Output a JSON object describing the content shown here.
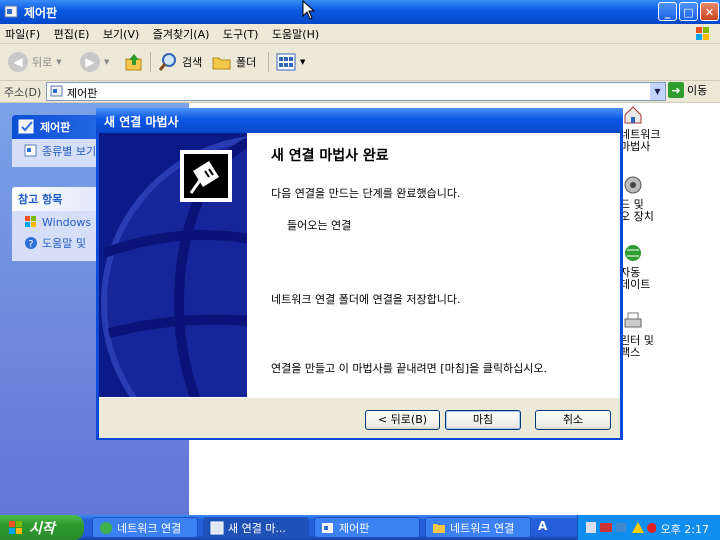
{
  "window": {
    "title": "제어판",
    "menu": [
      "파일(F)",
      "편집(E)",
      "보기(V)",
      "즐겨찾기(A)",
      "도구(T)",
      "도움말(H)"
    ],
    "toolbar": {
      "back_label": "뒤로",
      "search_label": "검색",
      "folders_label": "폴더"
    },
    "address": {
      "label": "주소(D)",
      "value": "제어판",
      "go_label": "이동"
    }
  },
  "taskpane": {
    "panel1": {
      "title": "제어판",
      "items": [
        "종류별 보기"
      ]
    },
    "panel2": {
      "title": "참고 항목",
      "items": [
        "Windows",
        "도움말 및"
      ]
    }
  },
  "right_items": [
    {
      "label1": "네트워크",
      "label2": "마법사"
    },
    {
      "label1": "드 및",
      "label2": "오 장치"
    },
    {
      "label1": "자동",
      "label2": "데이트"
    },
    {
      "label1": "린터 및",
      "label2": "팩스"
    }
  ],
  "dialog": {
    "title": "새 연결 마법사",
    "heading": "새 연결 마법사 완료",
    "line1": "다음 연결을 만드는 단계를 완료했습니다.",
    "connection": "들어오는 연결",
    "line2": "네트워크 연결 폴더에 연결을 저장합니다.",
    "line3": "연결을 만들고 이 마법사를 끝내려면 [마침]을 클릭하십시오.",
    "buttons": {
      "back": "< 뒤로(B)",
      "finish": "마침",
      "cancel": "취소"
    }
  },
  "taskbar": {
    "start": "시작",
    "items": [
      "네트워크 연결",
      "새 연결 마...",
      "제어판",
      "네트워크 연결"
    ],
    "lang": "A",
    "clock": "오후 2:17"
  }
}
